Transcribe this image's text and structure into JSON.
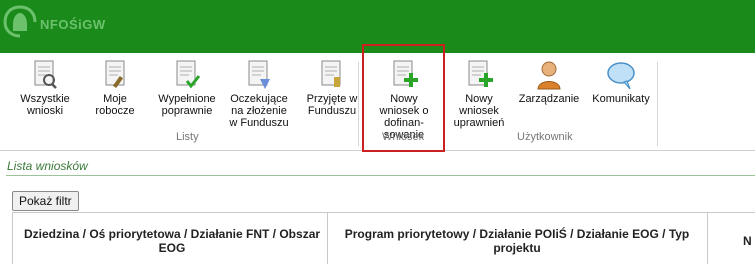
{
  "app": {
    "logo_text": "NFOŚiGW"
  },
  "ribbon": {
    "items": [
      {
        "label": "Wszystkie\nwnioski",
        "icon": "document-search-icon"
      },
      {
        "label": "Moje\nrobocze",
        "icon": "document-edit-icon"
      },
      {
        "label": "Wypełnione\npoprawnie",
        "icon": "document-check-icon"
      },
      {
        "label": "Oczekujące\nna złożenie\nw Funduszu",
        "icon": "document-pending-icon"
      },
      {
        "label": "Przyjęte w\nFunduszu",
        "icon": "document-accepted-icon"
      },
      {
        "label": "Nowy\nwniosek o\ndofinan-\nsowanie",
        "icon": "document-add-icon"
      },
      {
        "label": "Nowy\nwniosek\nuprawnień",
        "icon": "document-add-icon"
      },
      {
        "label": "Zarządzanie",
        "icon": "user-icon"
      },
      {
        "label": "Komunikaty",
        "icon": "speech-bubble-icon"
      }
    ],
    "groups": {
      "listy": "Listy",
      "wniosek": "Wniosek",
      "uzytkownik": "Użytkownik"
    }
  },
  "list": {
    "title": "Lista wniosków",
    "filter_button": "Pokaż filtr"
  },
  "table": {
    "headers": [
      "Dziedzina / Oś priorytetowa / Działanie FNT / Obszar EOG",
      "Program priorytetowy / Działanie POIiŚ / Działanie EOG / Typ projektu",
      "N"
    ]
  },
  "colors": {
    "header_green": "#1a8a1a",
    "highlight_red": "#cc1f1f",
    "title_green": "#3b7a3b"
  }
}
